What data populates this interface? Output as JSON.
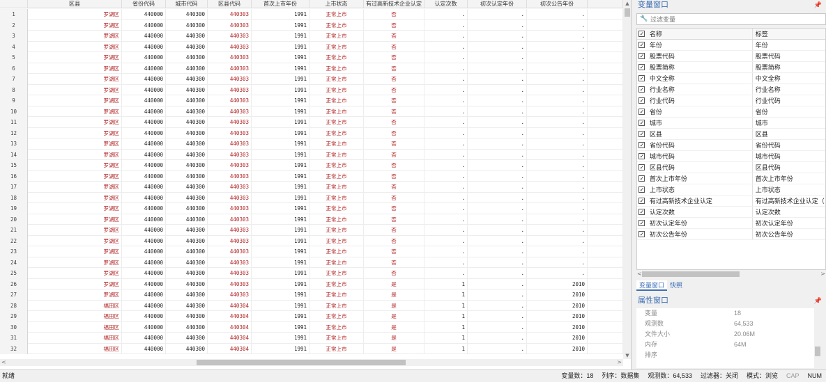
{
  "grid": {
    "columns": [
      {
        "label": "区县",
        "cls": "w-dist"
      },
      {
        "label": "省份代码",
        "cls": "w-prov"
      },
      {
        "label": "城市代码",
        "cls": "w-city"
      },
      {
        "label": "区县代码",
        "cls": "w-dcode"
      },
      {
        "label": "首次上市年份",
        "cls": "w-year"
      },
      {
        "label": "上市状态",
        "cls": "w-stat"
      },
      {
        "label": "有过高新技术企业认定",
        "cls": "w-hi"
      },
      {
        "label": "认定次数",
        "cls": "w-cnt"
      },
      {
        "label": "初次认定年份",
        "cls": "w-fy"
      },
      {
        "label": "初次公告年份",
        "cls": "w-fa"
      }
    ],
    "rows": [
      [
        "1",
        "罗湖区",
        "440000",
        "440300",
        "440303",
        "1991",
        "正常上市",
        "否",
        ".",
        ".",
        "."
      ],
      [
        "2",
        "罗湖区",
        "440000",
        "440300",
        "440303",
        "1991",
        "正常上市",
        "否",
        ".",
        ".",
        "."
      ],
      [
        "3",
        "罗湖区",
        "440000",
        "440300",
        "440303",
        "1991",
        "正常上市",
        "否",
        ".",
        ".",
        "."
      ],
      [
        "4",
        "罗湖区",
        "440000",
        "440300",
        "440303",
        "1991",
        "正常上市",
        "否",
        ".",
        ".",
        "."
      ],
      [
        "5",
        "罗湖区",
        "440000",
        "440300",
        "440303",
        "1991",
        "正常上市",
        "否",
        ".",
        ".",
        "."
      ],
      [
        "6",
        "罗湖区",
        "440000",
        "440300",
        "440303",
        "1991",
        "正常上市",
        "否",
        ".",
        ".",
        "."
      ],
      [
        "7",
        "罗湖区",
        "440000",
        "440300",
        "440303",
        "1991",
        "正常上市",
        "否",
        ".",
        ".",
        "."
      ],
      [
        "8",
        "罗湖区",
        "440000",
        "440300",
        "440303",
        "1991",
        "正常上市",
        "否",
        ".",
        ".",
        "."
      ],
      [
        "9",
        "罗湖区",
        "440000",
        "440300",
        "440303",
        "1991",
        "正常上市",
        "否",
        ".",
        ".",
        "."
      ],
      [
        "10",
        "罗湖区",
        "440000",
        "440300",
        "440303",
        "1991",
        "正常上市",
        "否",
        ".",
        ".",
        "."
      ],
      [
        "11",
        "罗湖区",
        "440000",
        "440300",
        "440303",
        "1991",
        "正常上市",
        "否",
        ".",
        ".",
        "."
      ],
      [
        "12",
        "罗湖区",
        "440000",
        "440300",
        "440303",
        "1991",
        "正常上市",
        "否",
        ".",
        ".",
        "."
      ],
      [
        "13",
        "罗湖区",
        "440000",
        "440300",
        "440303",
        "1991",
        "正常上市",
        "否",
        ".",
        ".",
        "."
      ],
      [
        "14",
        "罗湖区",
        "440000",
        "440300",
        "440303",
        "1991",
        "正常上市",
        "否",
        ".",
        ".",
        "."
      ],
      [
        "15",
        "罗湖区",
        "440000",
        "440300",
        "440303",
        "1991",
        "正常上市",
        "否",
        ".",
        ".",
        "."
      ],
      [
        "16",
        "罗湖区",
        "440000",
        "440300",
        "440303",
        "1991",
        "正常上市",
        "否",
        ".",
        ".",
        "."
      ],
      [
        "17",
        "罗湖区",
        "440000",
        "440300",
        "440303",
        "1991",
        "正常上市",
        "否",
        ".",
        ".",
        "."
      ],
      [
        "18",
        "罗湖区",
        "440000",
        "440300",
        "440303",
        "1991",
        "正常上市",
        "否",
        ".",
        ".",
        "."
      ],
      [
        "19",
        "罗湖区",
        "440000",
        "440300",
        "440303",
        "1991",
        "正常上市",
        "否",
        ".",
        ".",
        "."
      ],
      [
        "20",
        "罗湖区",
        "440000",
        "440300",
        "440303",
        "1991",
        "正常上市",
        "否",
        ".",
        ".",
        "."
      ],
      [
        "21",
        "罗湖区",
        "440000",
        "440300",
        "440303",
        "1991",
        "正常上市",
        "否",
        ".",
        ".",
        "."
      ],
      [
        "22",
        "罗湖区",
        "440000",
        "440300",
        "440303",
        "1991",
        "正常上市",
        "否",
        ".",
        ".",
        "."
      ],
      [
        "23",
        "罗湖区",
        "440000",
        "440300",
        "440303",
        "1991",
        "正常上市",
        "否",
        ".",
        ".",
        "."
      ],
      [
        "24",
        "罗湖区",
        "440000",
        "440300",
        "440303",
        "1991",
        "正常上市",
        "否",
        ".",
        ".",
        "."
      ],
      [
        "25",
        "罗湖区",
        "440000",
        "440300",
        "440303",
        "1991",
        "正常上市",
        "否",
        ".",
        ".",
        "."
      ],
      [
        "26",
        "罗湖区",
        "440000",
        "440300",
        "440303",
        "1991",
        "正常上市",
        "是",
        "1",
        ".",
        "2010"
      ],
      [
        "27",
        "罗湖区",
        "440000",
        "440300",
        "440303",
        "1991",
        "正常上市",
        "是",
        "1",
        ".",
        "2010"
      ],
      [
        "28",
        "福田区",
        "440000",
        "440300",
        "440304",
        "1991",
        "正常上市",
        "是",
        "1",
        ".",
        "2010"
      ],
      [
        "29",
        "福田区",
        "440000",
        "440300",
        "440304",
        "1991",
        "正常上市",
        "是",
        "1",
        ".",
        "2010"
      ],
      [
        "30",
        "福田区",
        "440000",
        "440300",
        "440304",
        "1991",
        "正常上市",
        "是",
        "1",
        ".",
        "2010"
      ],
      [
        "31",
        "福田区",
        "440000",
        "440300",
        "440304",
        "1991",
        "正常上市",
        "是",
        "1",
        ".",
        "2010"
      ],
      [
        "32",
        "福田区",
        "440000",
        "440300",
        "440304",
        "1991",
        "正常上市",
        "是",
        "1",
        ".",
        "2010"
      ]
    ]
  },
  "variables": {
    "title": "变量窗口",
    "filter_placeholder": "过滤变量",
    "col_name": "名称",
    "col_label": "标签",
    "items": [
      {
        "name": "年份",
        "label": "年份"
      },
      {
        "name": "股票代码",
        "label": "股票代码"
      },
      {
        "name": "股票简称",
        "label": "股票简称"
      },
      {
        "name": "中文全称",
        "label": "中文全称"
      },
      {
        "name": "行业名称",
        "label": "行业名称"
      },
      {
        "name": "行业代码",
        "label": "行业代码"
      },
      {
        "name": "省份",
        "label": "省份"
      },
      {
        "name": "城市",
        "label": "城市"
      },
      {
        "name": "区县",
        "label": "区县"
      },
      {
        "name": "省份代码",
        "label": "省份代码"
      },
      {
        "name": "城市代码",
        "label": "城市代码"
      },
      {
        "name": "区县代码",
        "label": "区县代码"
      },
      {
        "name": "首次上市年份",
        "label": "首次上市年份"
      },
      {
        "name": "上市状态",
        "label": "上市状态"
      },
      {
        "name": "有过高新技术企业认定",
        "label": "有过高新技术企业认定（"
      },
      {
        "name": "认定次数",
        "label": "认定次数"
      },
      {
        "name": "初次认定年份",
        "label": "初次认定年份"
      },
      {
        "name": "初次公告年份",
        "label": "初次公告年份"
      }
    ],
    "tabs": [
      "变量窗口",
      "快照"
    ]
  },
  "properties": {
    "title": "属性窗口",
    "items": [
      {
        "key": "变量",
        "value": "18"
      },
      {
        "key": "观测数",
        "value": "64,533"
      },
      {
        "key": "文件大小",
        "value": "20.06M"
      },
      {
        "key": "内存",
        "value": "64M"
      },
      {
        "key": "排序",
        "value": ""
      }
    ]
  },
  "status": {
    "ready": "就绪",
    "var_count": "变量数：18",
    "order": "列序：数据集",
    "obs": "观测数：64,533",
    "filter": "过滤器：关闭",
    "mode": "模式：浏览",
    "cap": "CAP",
    "num": "NUM"
  },
  "colors": {
    "accent": "#3d6fb3",
    "string_value": "#b22222"
  }
}
